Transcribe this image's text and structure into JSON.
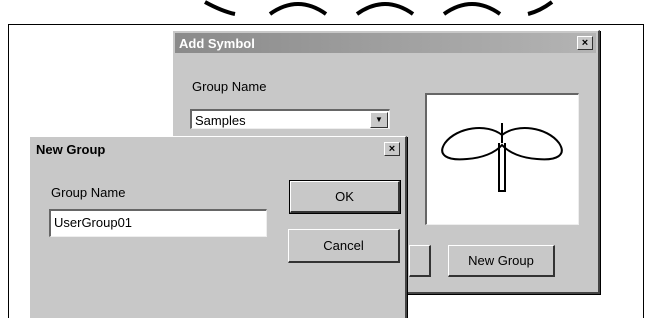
{
  "add_symbol": {
    "title": "Add Symbol",
    "close_label": "×",
    "group_name_label": "Group Name",
    "group_select_value": "Samples",
    "new_group_button": "New Group",
    "title_color": "#ffffff"
  },
  "new_group": {
    "title": "New Group",
    "close_label": "×",
    "group_name_label": "Group Name",
    "group_name_value": "UserGroup01",
    "ok_button": "OK",
    "cancel_button": "Cancel"
  },
  "icons": {
    "dropdown": "chevron-down-icon",
    "close": "close-icon",
    "symbol_preview": "propeller-symbol"
  }
}
